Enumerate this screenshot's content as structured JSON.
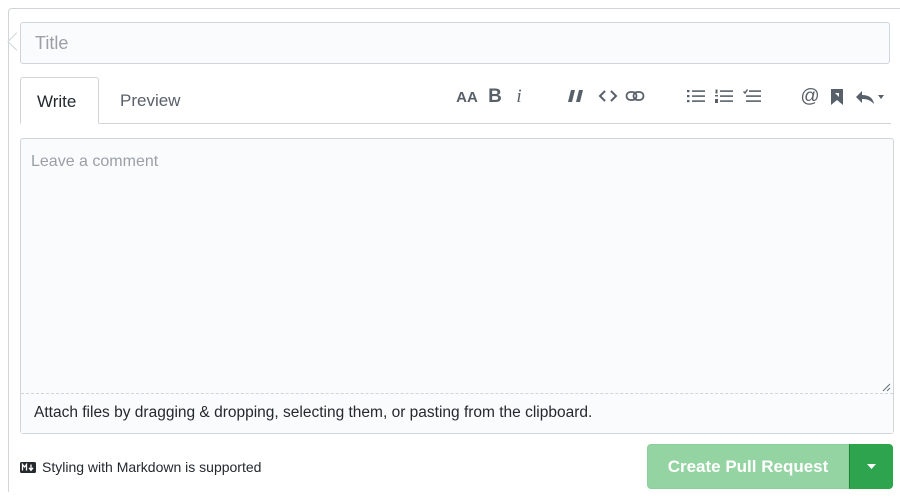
{
  "form": {
    "title_placeholder": "Title",
    "title_value": ""
  },
  "tabs": [
    {
      "label": "Write",
      "active": true
    },
    {
      "label": "Preview",
      "active": false
    }
  ],
  "toolbar": {
    "icons": [
      "text-size-icon",
      "bold-icon",
      "italic-icon",
      "quote-icon",
      "code-icon",
      "link-icon",
      "unordered-list-icon",
      "ordered-list-icon",
      "task-list-icon",
      "mention-icon",
      "saved-reply-icon",
      "reply-icon"
    ],
    "text_size_glyph": "AA",
    "bold_glyph": "B",
    "italic_glyph": "i",
    "mention_glyph": "@"
  },
  "comment": {
    "placeholder": "Leave a comment",
    "value": "",
    "attach_hint": "Attach files by dragging & dropping, selecting them, or pasting from the clipboard."
  },
  "footer": {
    "markdown_note": "Styling with Markdown is supported",
    "submit_label": "Create Pull Request"
  },
  "colors": {
    "submit_disabled": "#94d3a2",
    "submit_dropdown": "#2ea44f",
    "border": "#d1d5da",
    "icon": "#586069"
  }
}
